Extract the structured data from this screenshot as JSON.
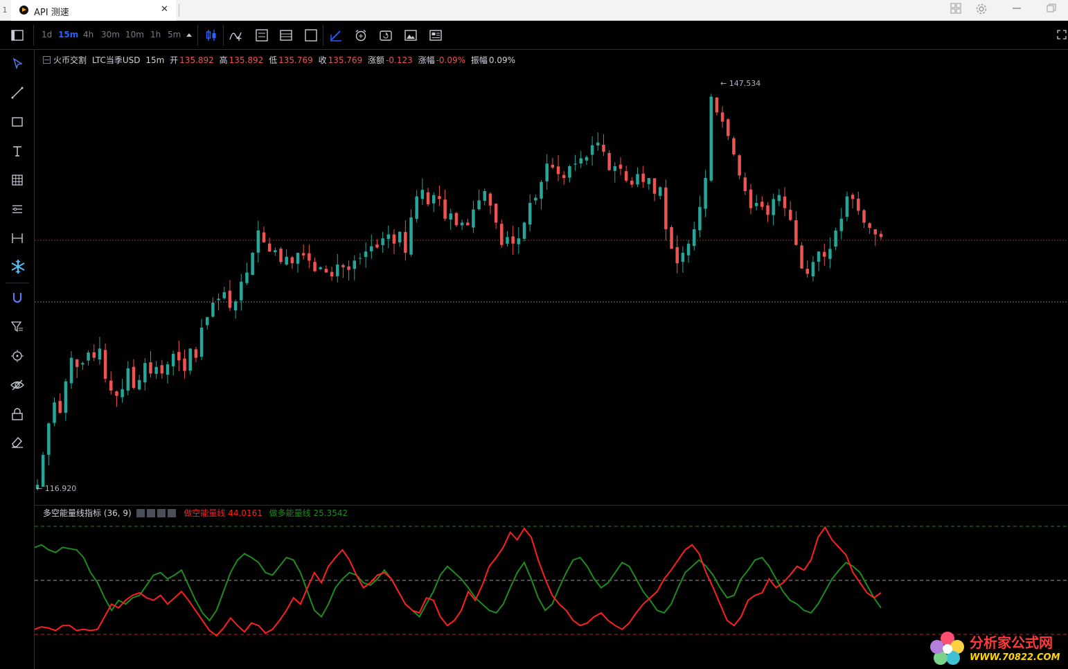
{
  "window": {
    "tab_index": "1",
    "tab_title": "API 测速",
    "tab_close": "✕"
  },
  "timeframes": [
    {
      "label": "1d",
      "active": false
    },
    {
      "label": "15m",
      "active": true
    },
    {
      "label": "4h",
      "active": false
    },
    {
      "label": "30m",
      "active": false
    },
    {
      "label": "10m",
      "active": false
    },
    {
      "label": "1h",
      "active": false
    },
    {
      "label": "5m",
      "active": false
    }
  ],
  "legend": {
    "exchange": "火币交割",
    "symbol": "LTC当季USD",
    "interval": "15m",
    "open_label": "开",
    "open": "135.892",
    "high_label": "高",
    "high": "135.892",
    "low_label": "低",
    "low": "135.769",
    "close_label": "收",
    "close": "135.769",
    "change_label": "涨额",
    "change": "-0.123",
    "change_pct_label": "涨幅",
    "change_pct": "-0.09%",
    "amplitude_label": "振幅",
    "amplitude": "0.09%"
  },
  "price_labels": {
    "max": "147.534",
    "min": "116.920"
  },
  "indicator": {
    "name": "多空能量线指标 (36, 9)",
    "short_label": "做空能量线",
    "short_value": "44.0161",
    "long_label": "做多能量线",
    "long_value": "25.3542"
  },
  "watermark": {
    "line1": "分析家公式网",
    "line2": "WWW.70822.COM"
  },
  "colors": {
    "up": "#26a69a",
    "down": "#ef5350",
    "accent": "#2962ff",
    "short_line": "#ff1f1f",
    "long_line": "#1e8c1e"
  },
  "chart_data": [
    {
      "type": "candlestick",
      "title": "LTC当季USD 15m",
      "ylim": [
        116.92,
        147.534
      ],
      "close": [
        116.92,
        119.2,
        121.6,
        123.2,
        122.4,
        124.8,
        126.6,
        125.9,
        126.2,
        127.0,
        126.6,
        127.3,
        125.0,
        124.1,
        123.7,
        124.2,
        125.8,
        124.3,
        124.9,
        126.2,
        125.4,
        125.9,
        125.4,
        126.1,
        126.9,
        126.4,
        125.6,
        127.3,
        126.6,
        128.9,
        129.7,
        130.8,
        131.1,
        131.6,
        130.4,
        130.9,
        132.4,
        133.1,
        134.6,
        136.3,
        135.4,
        134.7,
        134.8,
        133.9,
        134.3,
        133.8,
        134.6,
        134.4,
        134.0,
        133.2,
        133.5,
        133.1,
        132.8,
        133.7,
        133.5,
        133.3,
        134.0,
        134.2,
        134.7,
        135.1,
        135.0,
        135.7,
        136.0,
        135.3,
        136.2,
        134.6,
        137.3,
        138.9,
        139.4,
        138.3,
        139.0,
        138.7,
        137.2,
        137.6,
        136.7,
        136.9,
        136.7,
        137.9,
        138.6,
        139.3,
        138.2,
        136.9,
        135.2,
        135.8,
        135.3,
        135.7,
        136.9,
        138.4,
        138.8,
        140.0,
        141.4,
        141.1,
        140.6,
        140.3,
        141.2,
        141.4,
        141.8,
        141.9,
        142.8,
        143.0,
        142.3,
        140.9,
        141.2,
        141.0,
        140.1,
        139.8,
        140.6,
        140.0,
        140.3,
        139.1,
        139.6,
        136.4,
        134.9,
        133.8,
        134.6,
        135.3,
        136.4,
        138.1,
        140.3,
        146.5,
        145.3,
        144.6,
        143.5,
        142.1,
        140.5,
        139.3,
        138.0,
        138.4,
        138.1,
        137.5,
        138.7,
        139.0,
        138.0,
        137.1,
        135.2,
        133.4,
        133.0,
        133.9,
        134.7,
        134.3,
        134.9,
        136.3,
        137.2,
        138.9,
        138.7,
        137.8,
        136.9,
        136.5,
        136.0,
        135.8
      ]
    },
    {
      "type": "line",
      "title": "多空能量线指标 (36, 9)",
      "series": [
        {
          "name": "做空能量线",
          "values": [
            15,
            17,
            16,
            14,
            18,
            18,
            14,
            15,
            14,
            15,
            25,
            35,
            32,
            38,
            42,
            44,
            40,
            38,
            42,
            35,
            40,
            45,
            38,
            30,
            22,
            14,
            10,
            16,
            24,
            18,
            13,
            20,
            18,
            12,
            15,
            22,
            30,
            40,
            35,
            48,
            60,
            52,
            65,
            72,
            78,
            70,
            58,
            48,
            52,
            58,
            60,
            55,
            45,
            35,
            30,
            28,
            40,
            38,
            25,
            18,
            22,
            30,
            45,
            38,
            50,
            65,
            72,
            80,
            92,
            86,
            95,
            88,
            70,
            55,
            42,
            35,
            30,
            22,
            18,
            20,
            25,
            28,
            22,
            18,
            15,
            20,
            28,
            35,
            40,
            45,
            55,
            62,
            70,
            78,
            82,
            75,
            60,
            48,
            35,
            22,
            18,
            25,
            38,
            42,
            44,
            55,
            48,
            52,
            58,
            65,
            62,
            70,
            88,
            96,
            86,
            80,
            74,
            60,
            52,
            44,
            40,
            44
          ]
        },
        {
          "name": "做多能量线",
          "values": [
            80,
            82,
            78,
            76,
            80,
            79,
            78,
            72,
            60,
            52,
            40,
            30,
            38,
            35,
            40,
            42,
            50,
            58,
            60,
            55,
            58,
            62,
            50,
            38,
            28,
            22,
            30,
            45,
            60,
            70,
            75,
            72,
            68,
            60,
            58,
            65,
            72,
            70,
            60,
            45,
            30,
            25,
            35,
            48,
            55,
            60,
            58,
            52,
            50,
            55,
            62,
            55,
            45,
            35,
            30,
            25,
            35,
            45,
            58,
            65,
            60,
            55,
            48,
            40,
            35,
            30,
            28,
            35,
            48,
            60,
            68,
            55,
            40,
            30,
            35,
            48,
            60,
            70,
            72,
            65,
            55,
            48,
            52,
            60,
            68,
            65,
            55,
            45,
            38,
            30,
            28,
            35,
            48,
            60,
            65,
            70,
            65,
            58,
            48,
            40,
            42,
            55,
            62,
            70,
            72,
            65,
            55,
            45,
            38,
            35,
            30,
            28,
            35,
            45,
            55,
            62,
            68,
            65,
            60,
            50,
            40,
            32
          ]
        }
      ]
    }
  ]
}
